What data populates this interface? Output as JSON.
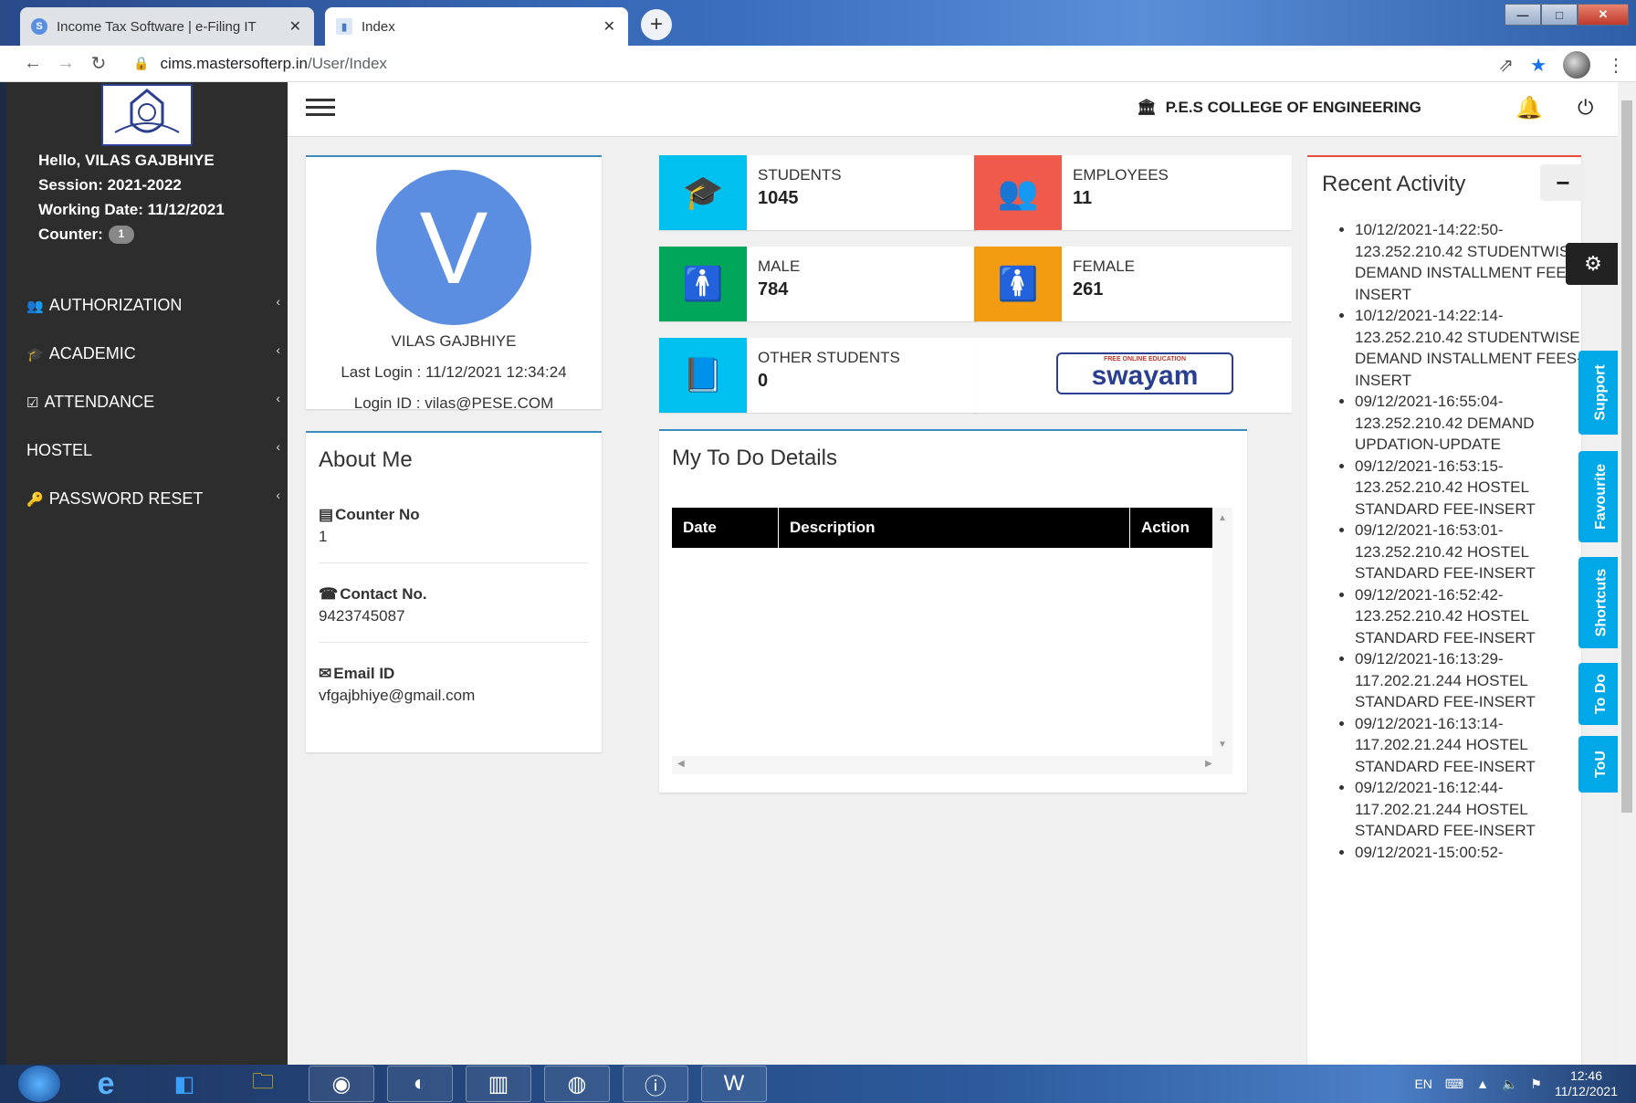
{
  "browser": {
    "tabs": [
      {
        "title": "Income Tax Software | e-Filing IT",
        "active": false,
        "icon": "s-favicon"
      },
      {
        "title": "Index",
        "active": true,
        "icon": "page-favicon"
      }
    ],
    "url_host": "cims.mastersofterp.in",
    "url_path": "/User/Index"
  },
  "sidebar": {
    "greeting": "Hello, VILAS GAJBHIYE",
    "session": "Session: 2021-2022",
    "working_date": "Working Date: 11/12/2021",
    "counter_label": "Counter:",
    "counter_value": "1",
    "menu": [
      {
        "label": "AUTHORIZATION",
        "icon": "user-plus-icon"
      },
      {
        "label": "ACADEMIC",
        "icon": "graduation-cap-icon"
      },
      {
        "label": "ATTENDANCE",
        "icon": "check-square-icon"
      },
      {
        "label": "HOSTEL",
        "icon": ""
      },
      {
        "label": "PASSWORD RESET",
        "icon": "key-icon"
      }
    ]
  },
  "header": {
    "college": "P.E.S COLLEGE OF ENGINEERING"
  },
  "profile": {
    "initial": "V",
    "name": "VILAS GAJBHIYE",
    "last_login": "Last Login : 11/12/2021 12:34:24",
    "login_id": "Login ID : vilas@PESE.COM"
  },
  "about": {
    "title": "About Me",
    "counter_label": "Counter No",
    "counter_value": "1",
    "contact_label": "Contact No.",
    "contact_value": "9423745087",
    "email_label": "Email ID",
    "email_value": "vfgajbhiye@gmail.com"
  },
  "stats": {
    "students": {
      "label": "STUDENTS",
      "value": "1045",
      "color": "#00c0ef"
    },
    "employees": {
      "label": "EMPLOYEES",
      "value": "11",
      "color": "#f05a4a"
    },
    "male": {
      "label": "MALE",
      "value": "784",
      "color": "#00a65a"
    },
    "female": {
      "label": "FEMALE",
      "value": "261",
      "color": "#f39c12"
    },
    "other": {
      "label": "OTHER STUDENTS",
      "value": "0",
      "color": "#00c0ef"
    }
  },
  "swayam": {
    "tagline": "FREE ONLINE EDUCATION",
    "brand": "swayam"
  },
  "todo": {
    "title": "My To Do Details",
    "columns": [
      "Date",
      "Description",
      "Action"
    ]
  },
  "activity": {
    "title": "Recent Activity",
    "collapse_label": "−",
    "items": [
      "10/12/2021-14:22:50-123.252.210.42 STUDENTWISE DEMAND INSTALLMENT FEES-INSERT",
      "10/12/2021-14:22:14-123.252.210.42 STUDENTWISE DEMAND INSTALLMENT FEES-INSERT",
      "09/12/2021-16:55:04-123.252.210.42 DEMAND UPDATION-UPDATE",
      "09/12/2021-16:53:15-123.252.210.42 HOSTEL STANDARD FEE-INSERT",
      "09/12/2021-16:53:01-123.252.210.42 HOSTEL STANDARD FEE-INSERT",
      "09/12/2021-16:52:42-123.252.210.42 HOSTEL STANDARD FEE-INSERT",
      "09/12/2021-16:13:29-117.202.21.244 HOSTEL STANDARD FEE-INSERT",
      "09/12/2021-16:13:14-117.202.21.244 HOSTEL STANDARD FEE-INSERT",
      "09/12/2021-16:12:44-117.202.21.244 HOSTEL STANDARD FEE-INSERT",
      "09/12/2021-15:00:52-"
    ]
  },
  "side_tabs": [
    "Support",
    "Favourite",
    "Shortcuts",
    "To Do",
    "ToU"
  ],
  "taskbar": {
    "lang": "EN",
    "time": "12:46",
    "date": "11/12/2021"
  }
}
